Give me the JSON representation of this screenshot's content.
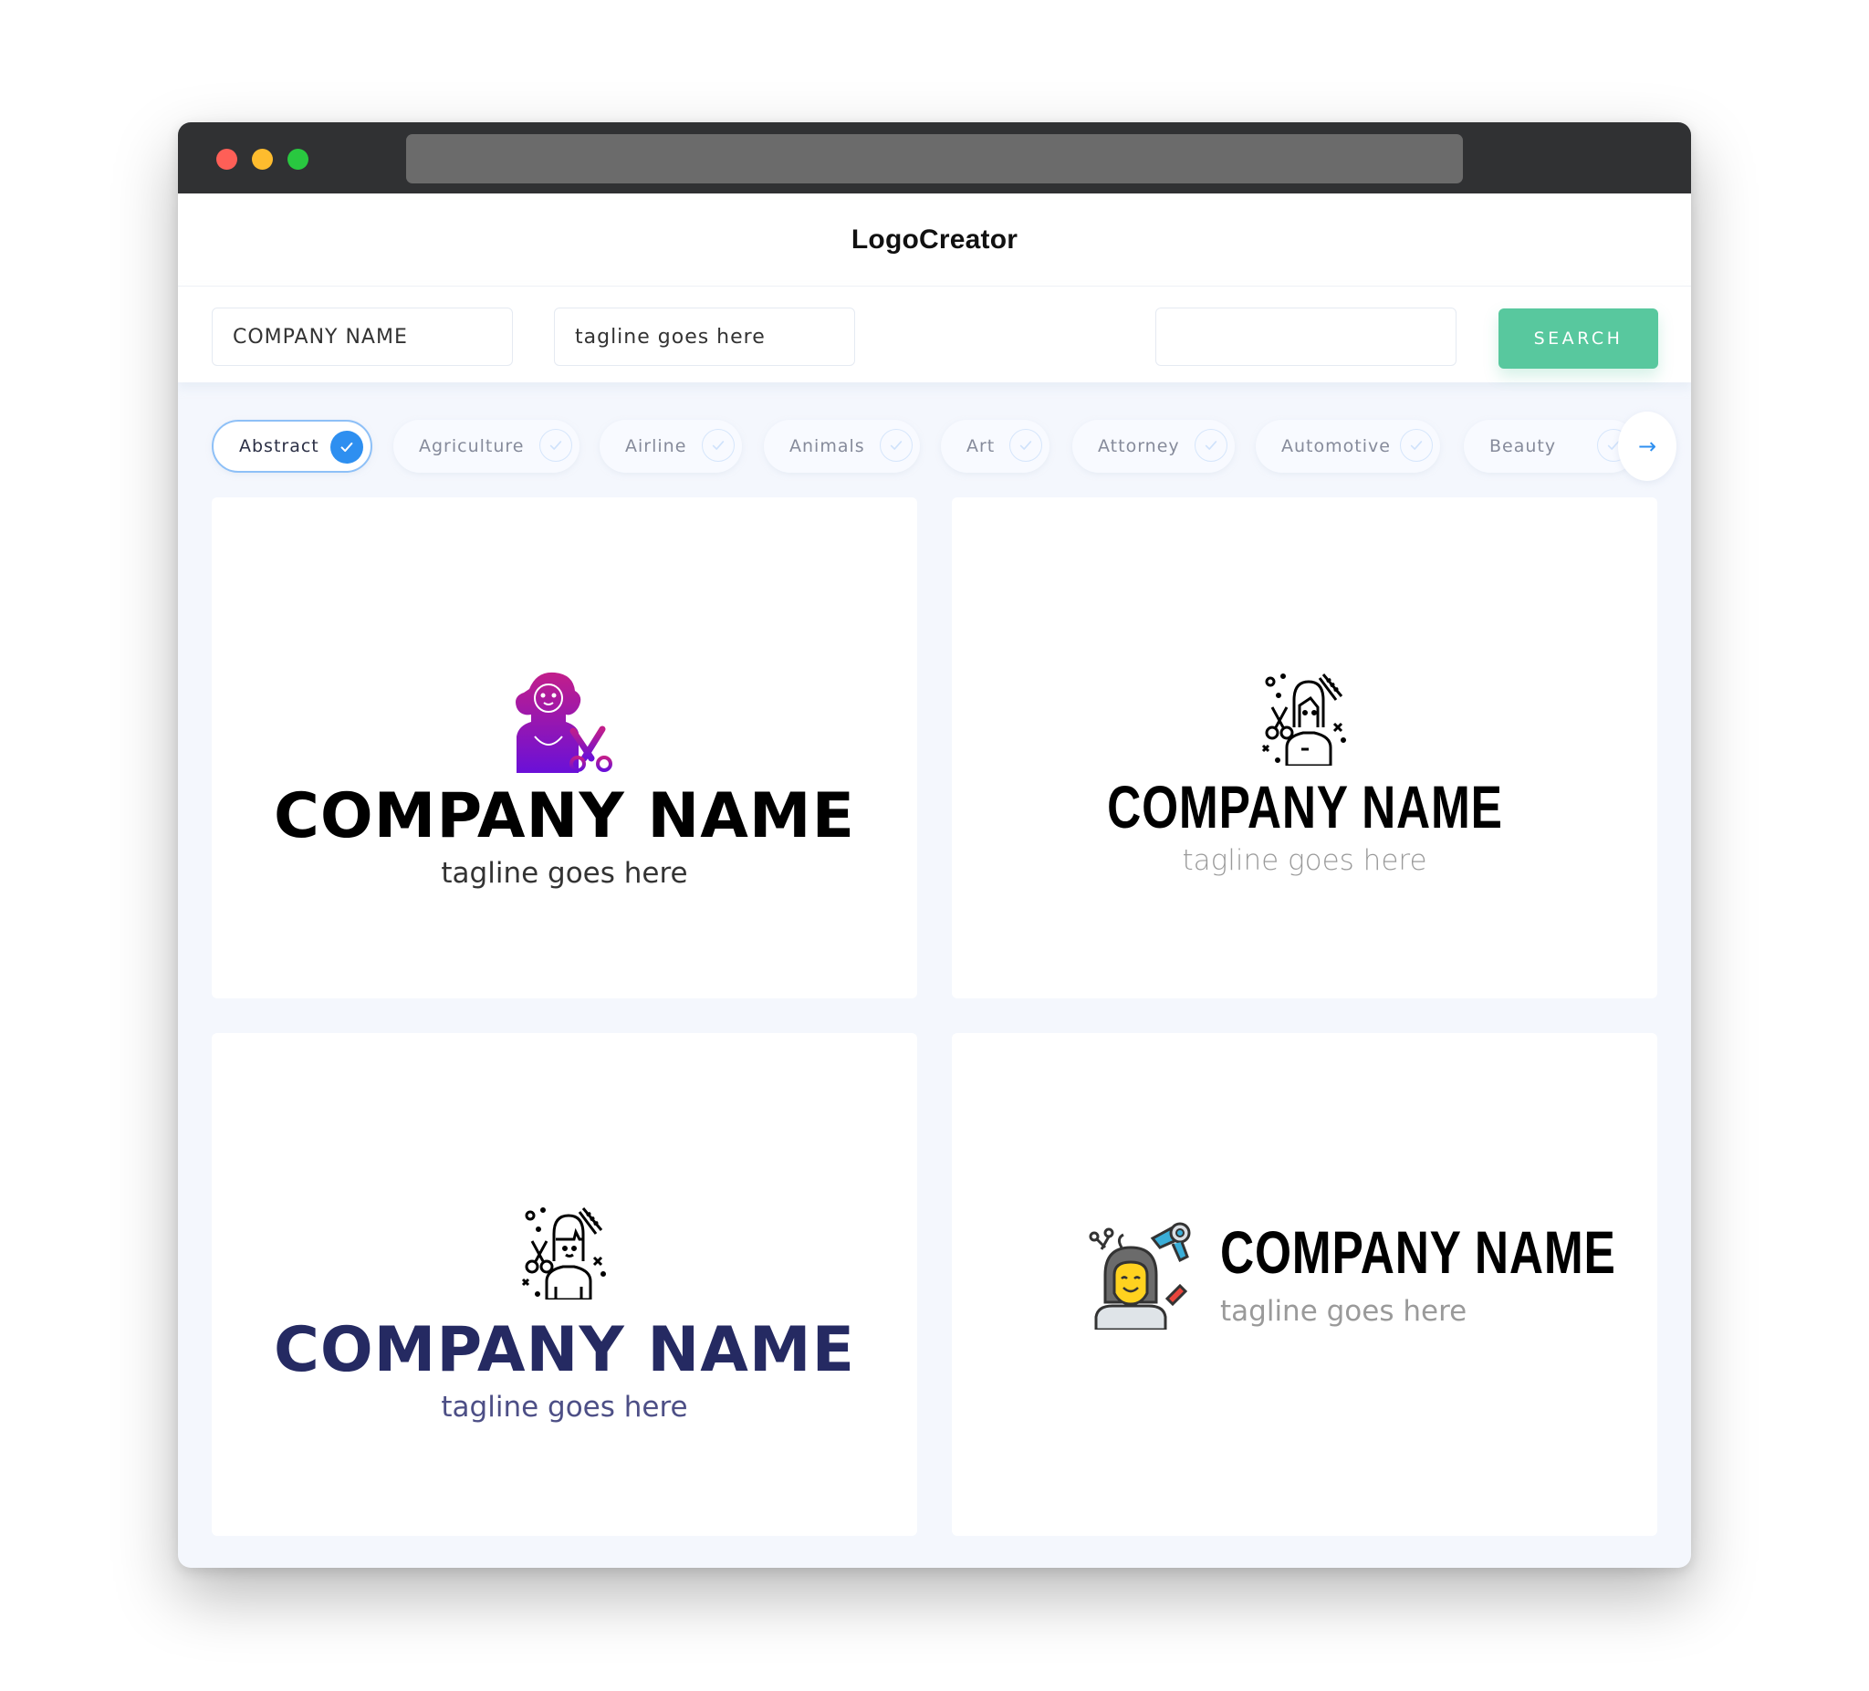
{
  "app": {
    "title": "LogoCreator"
  },
  "search": {
    "company_value": "COMPANY NAME",
    "tagline_value": "tagline goes here",
    "extra_value": "",
    "button_label": "SEARCH"
  },
  "categories": {
    "items": [
      {
        "label": "Abstract",
        "selected": true
      },
      {
        "label": "Agriculture",
        "selected": false
      },
      {
        "label": "Airline",
        "selected": false
      },
      {
        "label": "Animals",
        "selected": false
      },
      {
        "label": "Art",
        "selected": false
      },
      {
        "label": "Attorney",
        "selected": false
      },
      {
        "label": "Automotive",
        "selected": false
      },
      {
        "label": "Beauty",
        "selected": false
      }
    ],
    "next_icon": "arrow-right-icon"
  },
  "logos": [
    {
      "company": "COMPANY NAME",
      "tagline": "tagline goes here",
      "icon": "hairdresser-woman-scissors-gradient-icon",
      "name_color": "#000000",
      "icon_colors": [
        "#c21e8a",
        "#6a10d8"
      ]
    },
    {
      "company": "COMPANY NAME",
      "tagline": "tagline goes here",
      "icon": "hairdresser-outline-icon",
      "name_color": "#000000"
    },
    {
      "company": "COMPANY NAME",
      "tagline": "tagline goes here",
      "icon": "hairdresser-outline-icon",
      "name_color": "#252a62"
    },
    {
      "company": "COMPANY NAME",
      "tagline": "tagline goes here",
      "icon": "salon-woman-hairdryer-color-icon",
      "name_color": "#000000"
    }
  ],
  "colors": {
    "accent": "#58c89e",
    "chip_active": "#2e8ff0",
    "titlebar": "#303133"
  }
}
